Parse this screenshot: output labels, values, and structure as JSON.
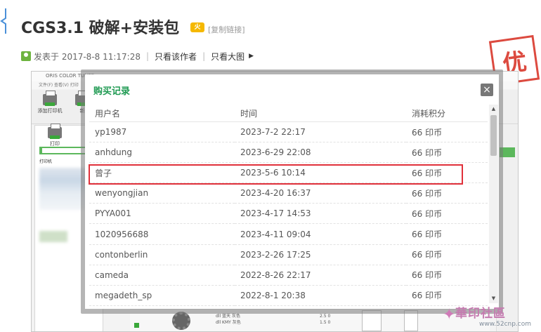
{
  "post": {
    "title": "CGS3.1 破解+安装包",
    "hot_badge": "火",
    "copy_link": "[复制链接]",
    "posted": "发表于 2017-8-8 11:17:28",
    "separator": "|",
    "only_author": "只看该作者",
    "big_image": "只看大图",
    "arrow": "▶"
  },
  "stamp": {
    "text": "优"
  },
  "background_app": {
    "window_title": "ORIS COLOR TUNER",
    "menu": "文件(F)   查看(V)   打印",
    "tools": [
      "添加打印机",
      "新"
    ],
    "tool_print": "打印",
    "pane_label": "打印机",
    "bottom_col1": [
      "dll 蓝天 灰色",
      "dll KMY 灰色"
    ],
    "bottom_nums": [
      "2.5   0",
      "1.5   0"
    ]
  },
  "modal": {
    "title": "购买记录",
    "close": "×",
    "columns": [
      "用户名",
      "时间",
      "消耗积分"
    ],
    "rows": [
      {
        "user": "yp1987",
        "time": "2023-7-2 22:17",
        "points": "66 印币"
      },
      {
        "user": "anhdung",
        "time": "2023-6-29 22:08",
        "points": "66 印币"
      },
      {
        "user": "曾子",
        "time": "2023-5-6 10:14",
        "points": "66 印币"
      },
      {
        "user": "wenyongjian",
        "time": "2023-4-20 16:37",
        "points": "66 印币"
      },
      {
        "user": "PYYA001",
        "time": "2023-4-17 14:53",
        "points": "66 印币"
      },
      {
        "user": "1020956688",
        "time": "2023-4-11 09:04",
        "points": "66 印币"
      },
      {
        "user": "contonberlin",
        "time": "2023-2-26 17:25",
        "points": "66 印币"
      },
      {
        "user": "cameda",
        "time": "2022-8-26 22:17",
        "points": "66 印币"
      },
      {
        "user": "megadeth_sp",
        "time": "2022-8-1 20:38",
        "points": "66 印币"
      }
    ],
    "scroll_up": "▲",
    "scroll_down": "▼"
  },
  "watermark": {
    "name": "華印社區",
    "url": "www.52cnp.com",
    "star": "✦"
  },
  "colors": {
    "title_green": "#1f9a52",
    "highlight_red": "#e0303a",
    "stamp_red": "#d9372b"
  }
}
